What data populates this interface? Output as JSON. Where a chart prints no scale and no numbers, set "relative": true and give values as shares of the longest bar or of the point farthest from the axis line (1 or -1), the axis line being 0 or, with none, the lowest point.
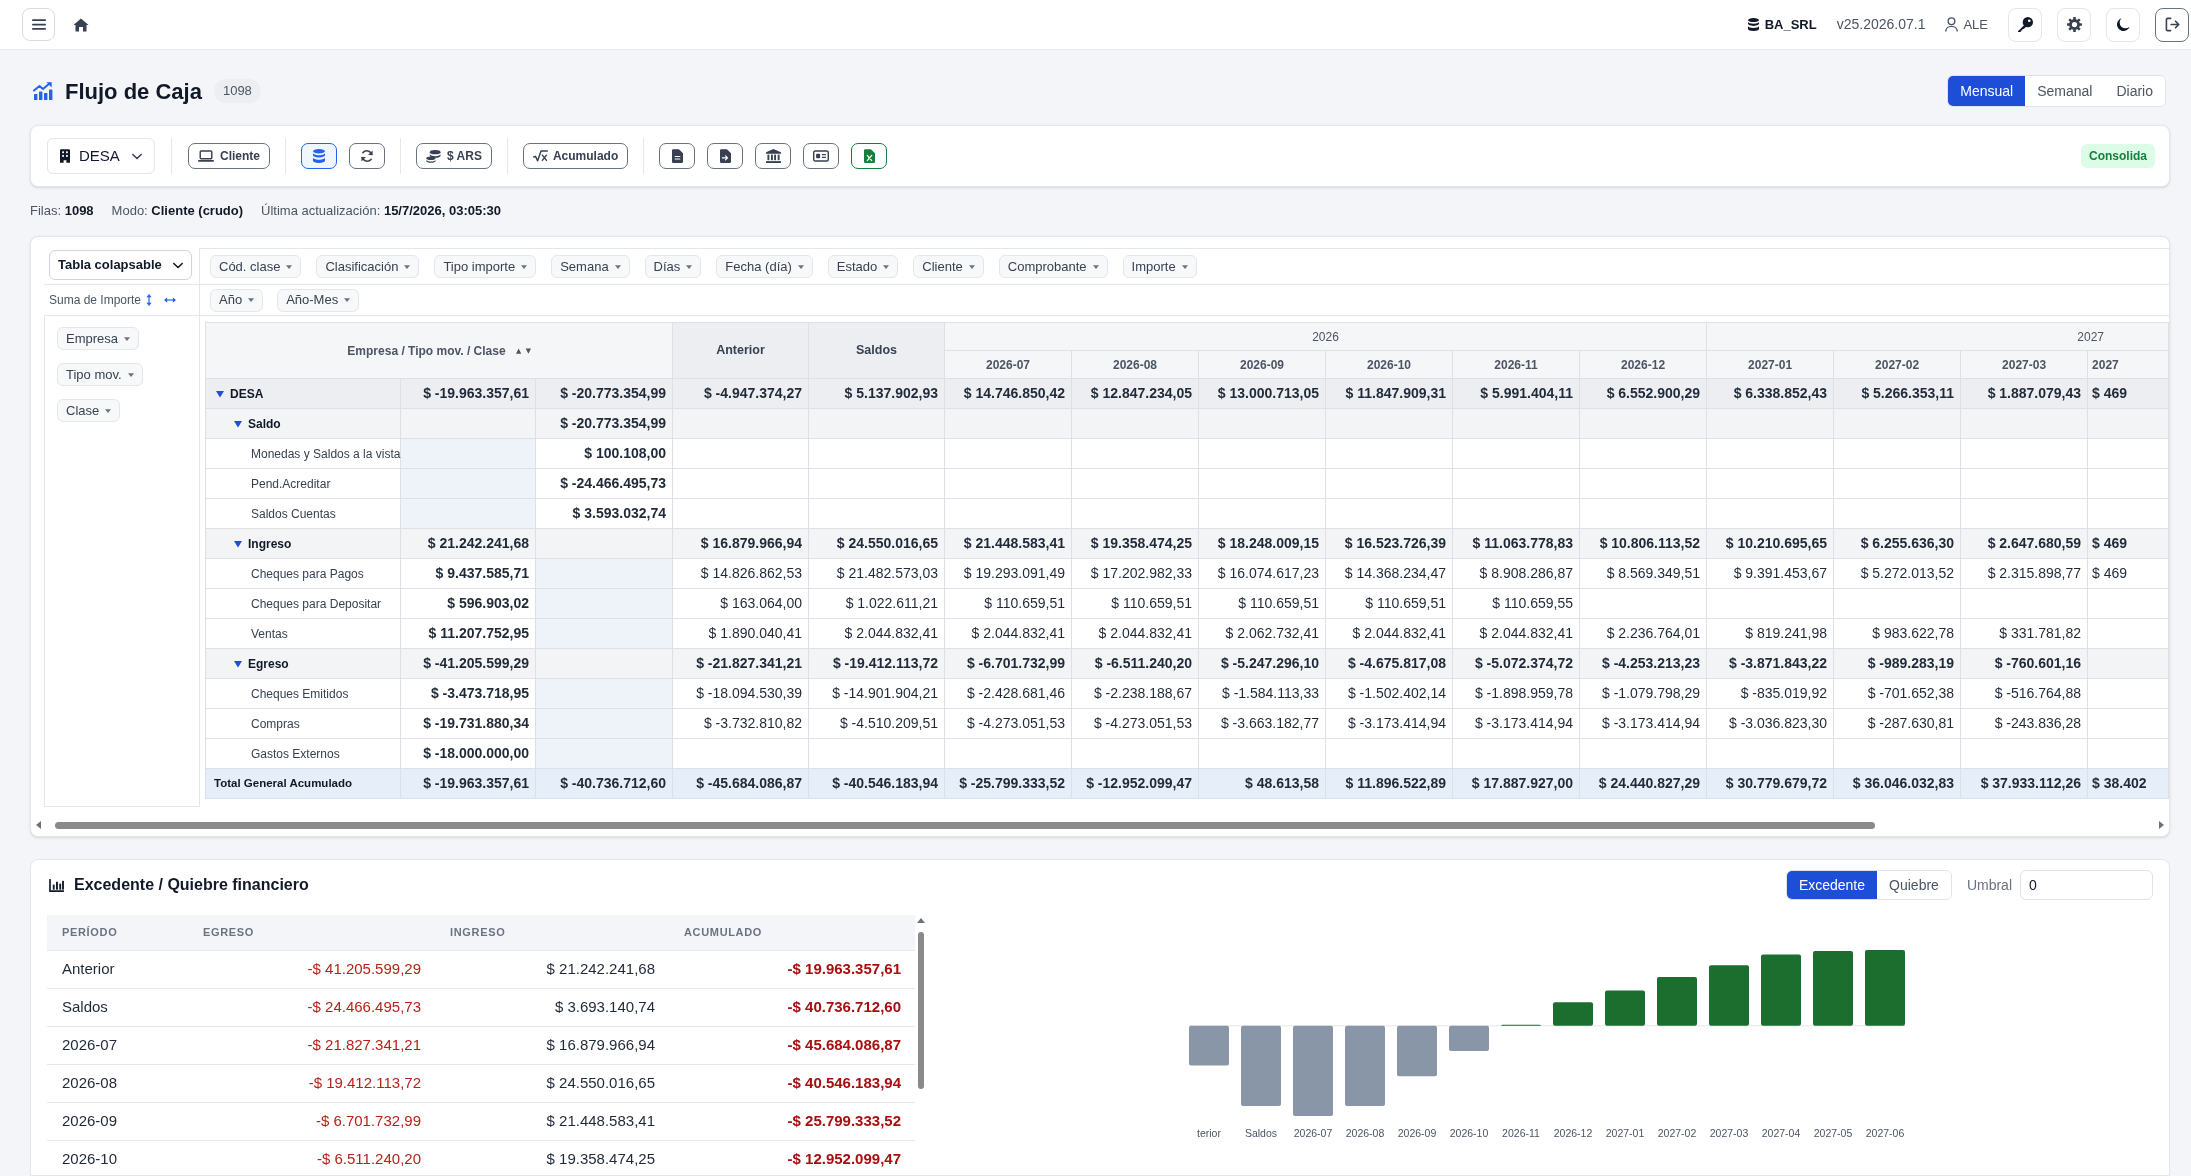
{
  "top_bar": {
    "database": "BA_SRL",
    "version": "v25.2026.07.1",
    "user": "ALE"
  },
  "header": {
    "title": "Flujo de Caja",
    "count": "1098",
    "periods": [
      {
        "label": "Mensual",
        "selected": true
      },
      {
        "label": "Semanal",
        "selected": false
      },
      {
        "label": "Diario",
        "selected": false
      }
    ]
  },
  "toolbar": {
    "company": "DESA",
    "mode_button": "Cliente",
    "source_toggle": {
      "selected": true
    },
    "currency_button": "$ ARS",
    "accumulate_button": "Acumulado",
    "status_badge": "Consolida"
  },
  "info": [
    "Filas: **1098**",
    "Modo: **Cliente (crudo)**",
    "Última actualización: **15/7/2026, 03:05:30**"
  ],
  "pivot": {
    "renderer": "Tabla colapsable",
    "aggregator": "Suma de Importe",
    "unused_fields": [
      "Cód. clase",
      "Clasificación",
      "Tipo importe",
      "Semana",
      "Días",
      "Fecha (día)",
      "Estado",
      "Cliente",
      "Comprobante",
      "Importe"
    ],
    "column_fields": [
      "Año",
      "Año-Mes"
    ],
    "row_fields": [
      "Empresa",
      "Tipo mov.",
      "Clase"
    ],
    "table": {
      "row_header": "Empresa / Tipo mov. / Clase",
      "columns": [
        {
          "label": "Anterior"
        },
        {
          "label": "Saldos"
        },
        {
          "label": "2026",
          "children": [
            "2026-07",
            "2026-08",
            "2026-09",
            "2026-10",
            "2026-11",
            "2026-12"
          ]
        },
        {
          "label": "2027",
          "children": [
            "2027-01",
            "2027-02",
            "2027-03",
            "2027"
          ]
        }
      ],
      "rows": [
        {
          "label": "DESA",
          "expanded": true,
          "column_2": "$ -19.963.357,61",
          "column_3": "$ -20.773.354,99",
          "values": [
            "$ -4.947.374,27",
            "$ 5.137.902,93",
            "$ 14.746.850,42",
            "$ 12.847.234,05",
            "$ 13.000.713,05",
            "$ 11.847.909,31",
            "$ 5.991.404,11",
            "$ 6.552.900,29",
            "$ 6.338.852,43",
            "$ 5.266.353,11",
            "$ 1.887.079,43",
            "$ 469"
          ],
          "children": [
            {
              "label": "Saldo",
              "expanded": true,
              "column_3": "$ -20.773.354,99",
              "children": [
                {
                  "label": "Monedas y Saldos a la vista",
                  "column_3": "$ 100.108,00"
                },
                {
                  "label": "Pend.Acreditar",
                  "column_3": "$ -24.466.495,73"
                },
                {
                  "label": "Saldos Cuentas",
                  "column_3": "$ 3.593.032,74"
                }
              ]
            },
            {
              "label": "Ingreso",
              "expanded": true,
              "column_2": "$ 21.242.241,68",
              "values": [
                "$ 16.879.966,94",
                "$ 24.550.016,65",
                "$ 21.448.583,41",
                "$ 19.358.474,25",
                "$ 18.248.009,15",
                "$ 16.523.726,39",
                "$ 11.063.778,83",
                "$ 10.806.113,52",
                "$ 10.210.695,65",
                "$ 6.255.636,30",
                "$ 2.647.680,59",
                "$ 469"
              ],
              "children": [
                {
                  "label": "Cheques para Pagos",
                  "column_2": "$ 9.437.585,71",
                  "values": [
                    "$ 14.826.862,53",
                    "$ 21.482.573,03",
                    "$ 19.293.091,49",
                    "$ 17.202.982,33",
                    "$ 16.074.617,23",
                    "$ 14.368.234,47",
                    "$ 8.908.286,87",
                    "$ 8.569.349,51",
                    "$ 9.391.453,67",
                    "$ 5.272.013,52",
                    "$ 2.315.898,77",
                    "$ 469"
                  ]
                },
                {
                  "label": "Cheques para Depositar",
                  "column_2": "$ 596.903,02",
                  "values": [
                    "$ 163.064,00",
                    "$ 1.022.611,21",
                    "$ 110.659,51",
                    "$ 110.659,51",
                    "$ 110.659,51",
                    "$ 110.659,51",
                    "$ 110.659,55"
                  ]
                },
                {
                  "label": "Ventas",
                  "column_2": "$ 11.207.752,95",
                  "values": [
                    "$ 1.890.040,41",
                    "$ 2.044.832,41",
                    "$ 2.044.832,41",
                    "$ 2.044.832,41",
                    "$ 2.062.732,41",
                    "$ 2.044.832,41",
                    "$ 2.044.832,41",
                    "$ 2.236.764,01",
                    "$ 819.241,98",
                    "$ 983.622,78",
                    "$ 331.781,82"
                  ]
                }
              ]
            },
            {
              "label": "Egreso",
              "expanded": true,
              "column_2": "$ -41.205.599,29",
              "values": [
                "$ -21.827.341,21",
                "$ -19.412.113,72",
                "$ -6.701.732,99",
                "$ -6.511.240,20",
                "$ -5.247.296,10",
                "$ -4.675.817,08",
                "$ -5.072.374,72",
                "$ -4.253.213,23",
                "$ -3.871.843,22",
                "$ -989.283,19",
                "$ -760.601,16"
              ],
              "children": [
                {
                  "label": "Cheques Emitidos",
                  "column_2": "$ -3.473.718,95",
                  "values": [
                    "$ -18.094.530,39",
                    "$ -14.901.904,21",
                    "$ -2.428.681,46",
                    "$ -2.238.188,67",
                    "$ -1.584.113,33",
                    "$ -1.502.402,14",
                    "$ -1.898.959,78",
                    "$ -1.079.798,29",
                    "$ -835.019,92",
                    "$ -701.652,38",
                    "$ -516.764,88"
                  ]
                },
                {
                  "label": "Compras",
                  "column_2": "$ -19.731.880,34",
                  "values": [
                    "$ -3.732.810,82",
                    "$ -4.510.209,51",
                    "$ -4.273.051,53",
                    "$ -4.273.051,53",
                    "$ -3.663.182,77",
                    "$ -3.173.414,94",
                    "$ -3.173.414,94",
                    "$ -3.173.414,94",
                    "$ -3.036.823,30",
                    "$ -287.630,81",
                    "$ -243.836,28"
                  ]
                },
                {
                  "label": "Gastos Externos",
                  "column_2": "$ -18.000.000,00"
                }
              ]
            }
          ]
        }
      ],
      "total": {
        "label": "Total General Acumulado",
        "column_2": "$ -19.963.357,61",
        "column_3": "$ -40.736.712,60",
        "values": [
          "$ -45.684.086,87",
          "$ -40.546.183,94",
          "$ -25.799.333,52",
          "$ -12.952.099,47",
          "$ 48.613,58",
          "$ 11.896.522,89",
          "$ 17.887.927,00",
          "$ 24.440.827,29",
          "$ 30.779.679,72",
          "$ 36.046.032,83",
          "$ 37.933.112,26",
          "$ 38.402"
        ]
      }
    }
  },
  "cashflow": {
    "title": "Excedente / Quiebre financiero",
    "modes": [
      {
        "label": "Excedente",
        "selected": true
      },
      {
        "label": "Quiebre",
        "selected": false
      }
    ],
    "threshold": {
      "label": "Umbral",
      "value": "0"
    },
    "table": {
      "columns": [
        "PERÍODO",
        "EGRESO",
        "INGRESO",
        "ACUMULADO"
      ],
      "rows": [
        {
          "period": "Anterior",
          "egreso": "-$ 41.205.599,29",
          "ingreso": "$ 21.242.241,68",
          "acumulado": "-$ 19.963.357,61",
          "deficit": true
        },
        {
          "period": "Saldos",
          "egreso": "-$ 24.466.495,73",
          "ingreso": "$ 3.693.140,74",
          "acumulado": "-$ 40.736.712,60",
          "deficit": true
        },
        {
          "period": "2026-07",
          "egreso": "-$ 21.827.341,21",
          "ingreso": "$ 16.879.966,94",
          "acumulado": "-$ 45.684.086,87",
          "deficit": true
        },
        {
          "period": "2026-08",
          "egreso": "-$ 19.412.113,72",
          "ingreso": "$ 24.550.016,65",
          "acumulado": "-$ 40.546.183,94",
          "deficit": true
        },
        {
          "period": "2026-09",
          "egreso": "-$ 6.701.732,99",
          "ingreso": "$ 21.448.583,41",
          "acumulado": "-$ 25.799.333,52",
          "deficit": true
        },
        {
          "period": "2026-10",
          "egreso": "-$ 6.511.240,20",
          "ingreso": "$ 19.358.474,25",
          "acumulado": "-$ 12.952.099,47",
          "deficit": true
        }
      ]
    },
    "chart_data": {
      "type": "bar",
      "relative": true,
      "categories": [
        "terior",
        "Saldos",
        "2026-07",
        "2026-08",
        "2026-09",
        "2026-10",
        "2026-11",
        "2026-12",
        "2027-01",
        "2027-02",
        "2027-03",
        "2027-04",
        "2027-05",
        "2027-06"
      ],
      "values": [
        -0.44,
        -0.89,
        -1.0,
        -0.89,
        -0.56,
        -0.28,
        0.0,
        0.26,
        0.39,
        0.54,
        0.67,
        0.79,
        0.83,
        0.84
      ]
    }
  }
}
